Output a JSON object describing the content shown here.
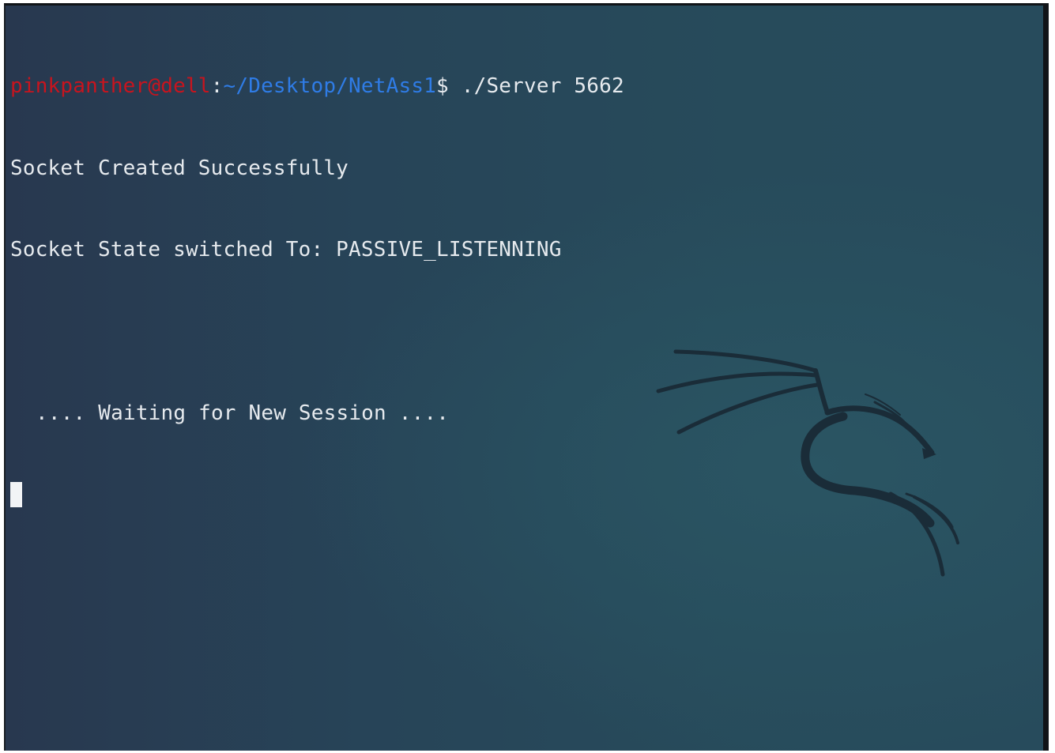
{
  "terminal": {
    "prompt": {
      "user_host": "pinkpanther@dell",
      "separator": ":",
      "path": "~/Desktop/NetAss1",
      "symbol": "$",
      "command": " ./Server 5662"
    },
    "output": [
      "Socket Created Successfully",
      "Socket State switched To: PASSIVE_LISTENNING",
      "",
      ".... Waiting for New Session ...."
    ]
  },
  "wallpaper": {
    "logo_icon": "kali-dragon-icon"
  },
  "colors": {
    "prompt_user": "#c8141e",
    "prompt_path": "#2f7ce6",
    "text": "#e6eaee",
    "background": "#274458",
    "logo": "#1a2c38"
  }
}
